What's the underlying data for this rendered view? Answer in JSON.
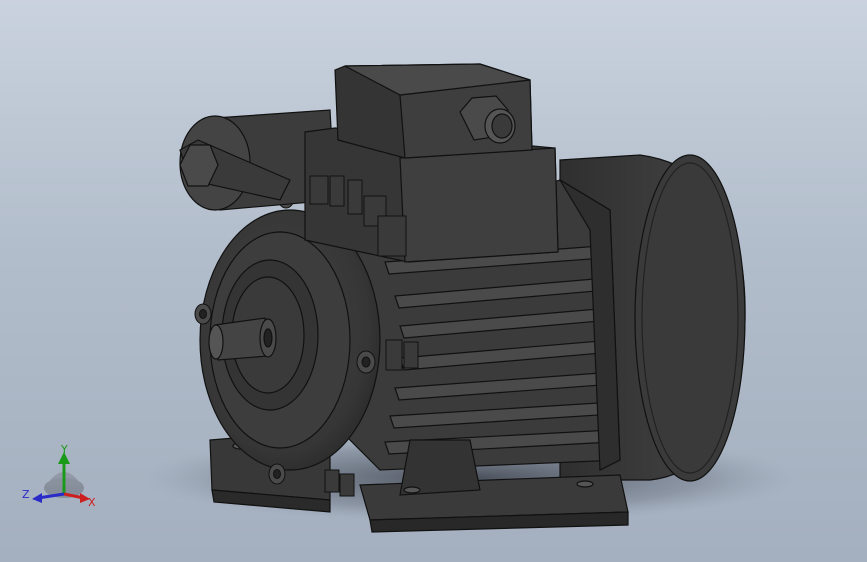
{
  "viewport": {
    "background_top": "#c9d2de",
    "background_bottom": "#a4afbf"
  },
  "model": {
    "body_color": "#3c3c3c",
    "edge_color": "#111111"
  },
  "triad": {
    "x_label": "X",
    "y_label": "Y",
    "z_label": "Z",
    "x_color": "#cc2020",
    "y_color": "#1a9a1a",
    "z_color": "#2a2ac8"
  }
}
